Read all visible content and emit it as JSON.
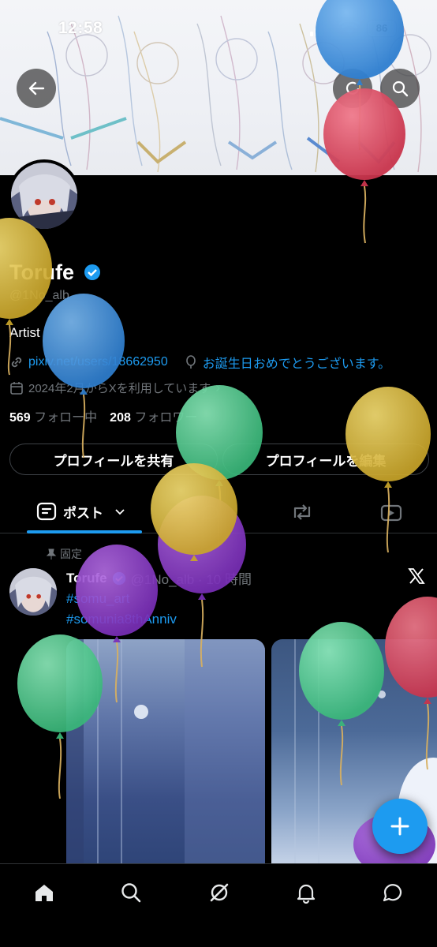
{
  "status": {
    "time": "12:58",
    "battery": "86"
  },
  "header": {
    "back_icon": "arrow-left-icon",
    "search_icon": "search-icon"
  },
  "profile": {
    "name": "Torufe",
    "handle": "@1No_alb",
    "bio": "Artist",
    "website": "pixiv.net/users/18662950",
    "birthday": "お誕生日おめでとうございます。",
    "joined": "2024年2月からXを利用しています",
    "following_count": "569",
    "following_label": "フォロー中",
    "followers_count": "208",
    "followers_label": "フォロワー"
  },
  "actions": {
    "share": "プロフィールを共有",
    "edit": "プロフィールを編集"
  },
  "tabs": {
    "posts": "ポスト"
  },
  "post": {
    "pinned_label": "固定",
    "author": "Torufe",
    "meta": "@1No_alb · 10 時間",
    "hashtag1": "#somu_art",
    "hashtag2": "#somunia8thAnniv"
  },
  "colors": {
    "accent": "#1d9bf0",
    "background": "#000000",
    "muted": "#71767b"
  }
}
